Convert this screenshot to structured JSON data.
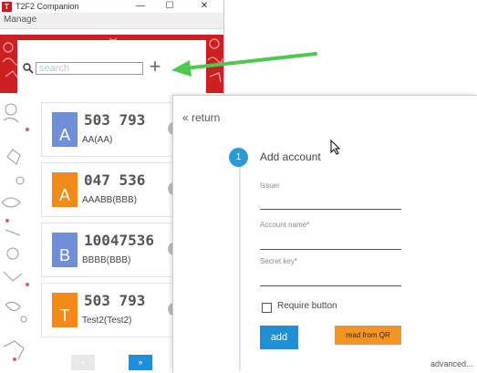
{
  "window": {
    "title": "T2F2 Companion",
    "logo_text": "T",
    "controls": {
      "minimize": "—",
      "maximize": "☐",
      "close": "✕"
    },
    "menu": {
      "manage": "Manage"
    },
    "brand_color": "#cc1f1f"
  },
  "search": {
    "placeholder": "search",
    "add_icon": "plus-icon"
  },
  "accounts": [
    {
      "letter": "A",
      "code": "503 793",
      "label": "AA(AA)",
      "color": "#6f8fd8"
    },
    {
      "letter": "A",
      "code": "047 536",
      "label": "AAABB(BBB)",
      "color": "#f28a1a"
    },
    {
      "letter": "B",
      "code": "10047536",
      "label": "BBBB(BBB)",
      "color": "#6f8fd8"
    },
    {
      "letter": "T",
      "code": "503 793",
      "label": "Test2(Test2)",
      "color": "#f28a1a"
    }
  ],
  "pagination": {
    "prev": "«",
    "next": "»"
  },
  "dialog": {
    "return_label": "« return",
    "step_number": "1",
    "step_title": "Add account",
    "fields": [
      {
        "label": "Issuer"
      },
      {
        "label": "Account name*"
      },
      {
        "label": "Secret key*"
      }
    ],
    "require_button_label": "Require button",
    "add_button_label": "add",
    "qr_button_label": "read from QR",
    "advanced_label": "advanced..."
  },
  "colors": {
    "accent_blue": "#1f8fd6",
    "accent_orange": "#f29523",
    "arrow_green": "#4ec94e"
  }
}
